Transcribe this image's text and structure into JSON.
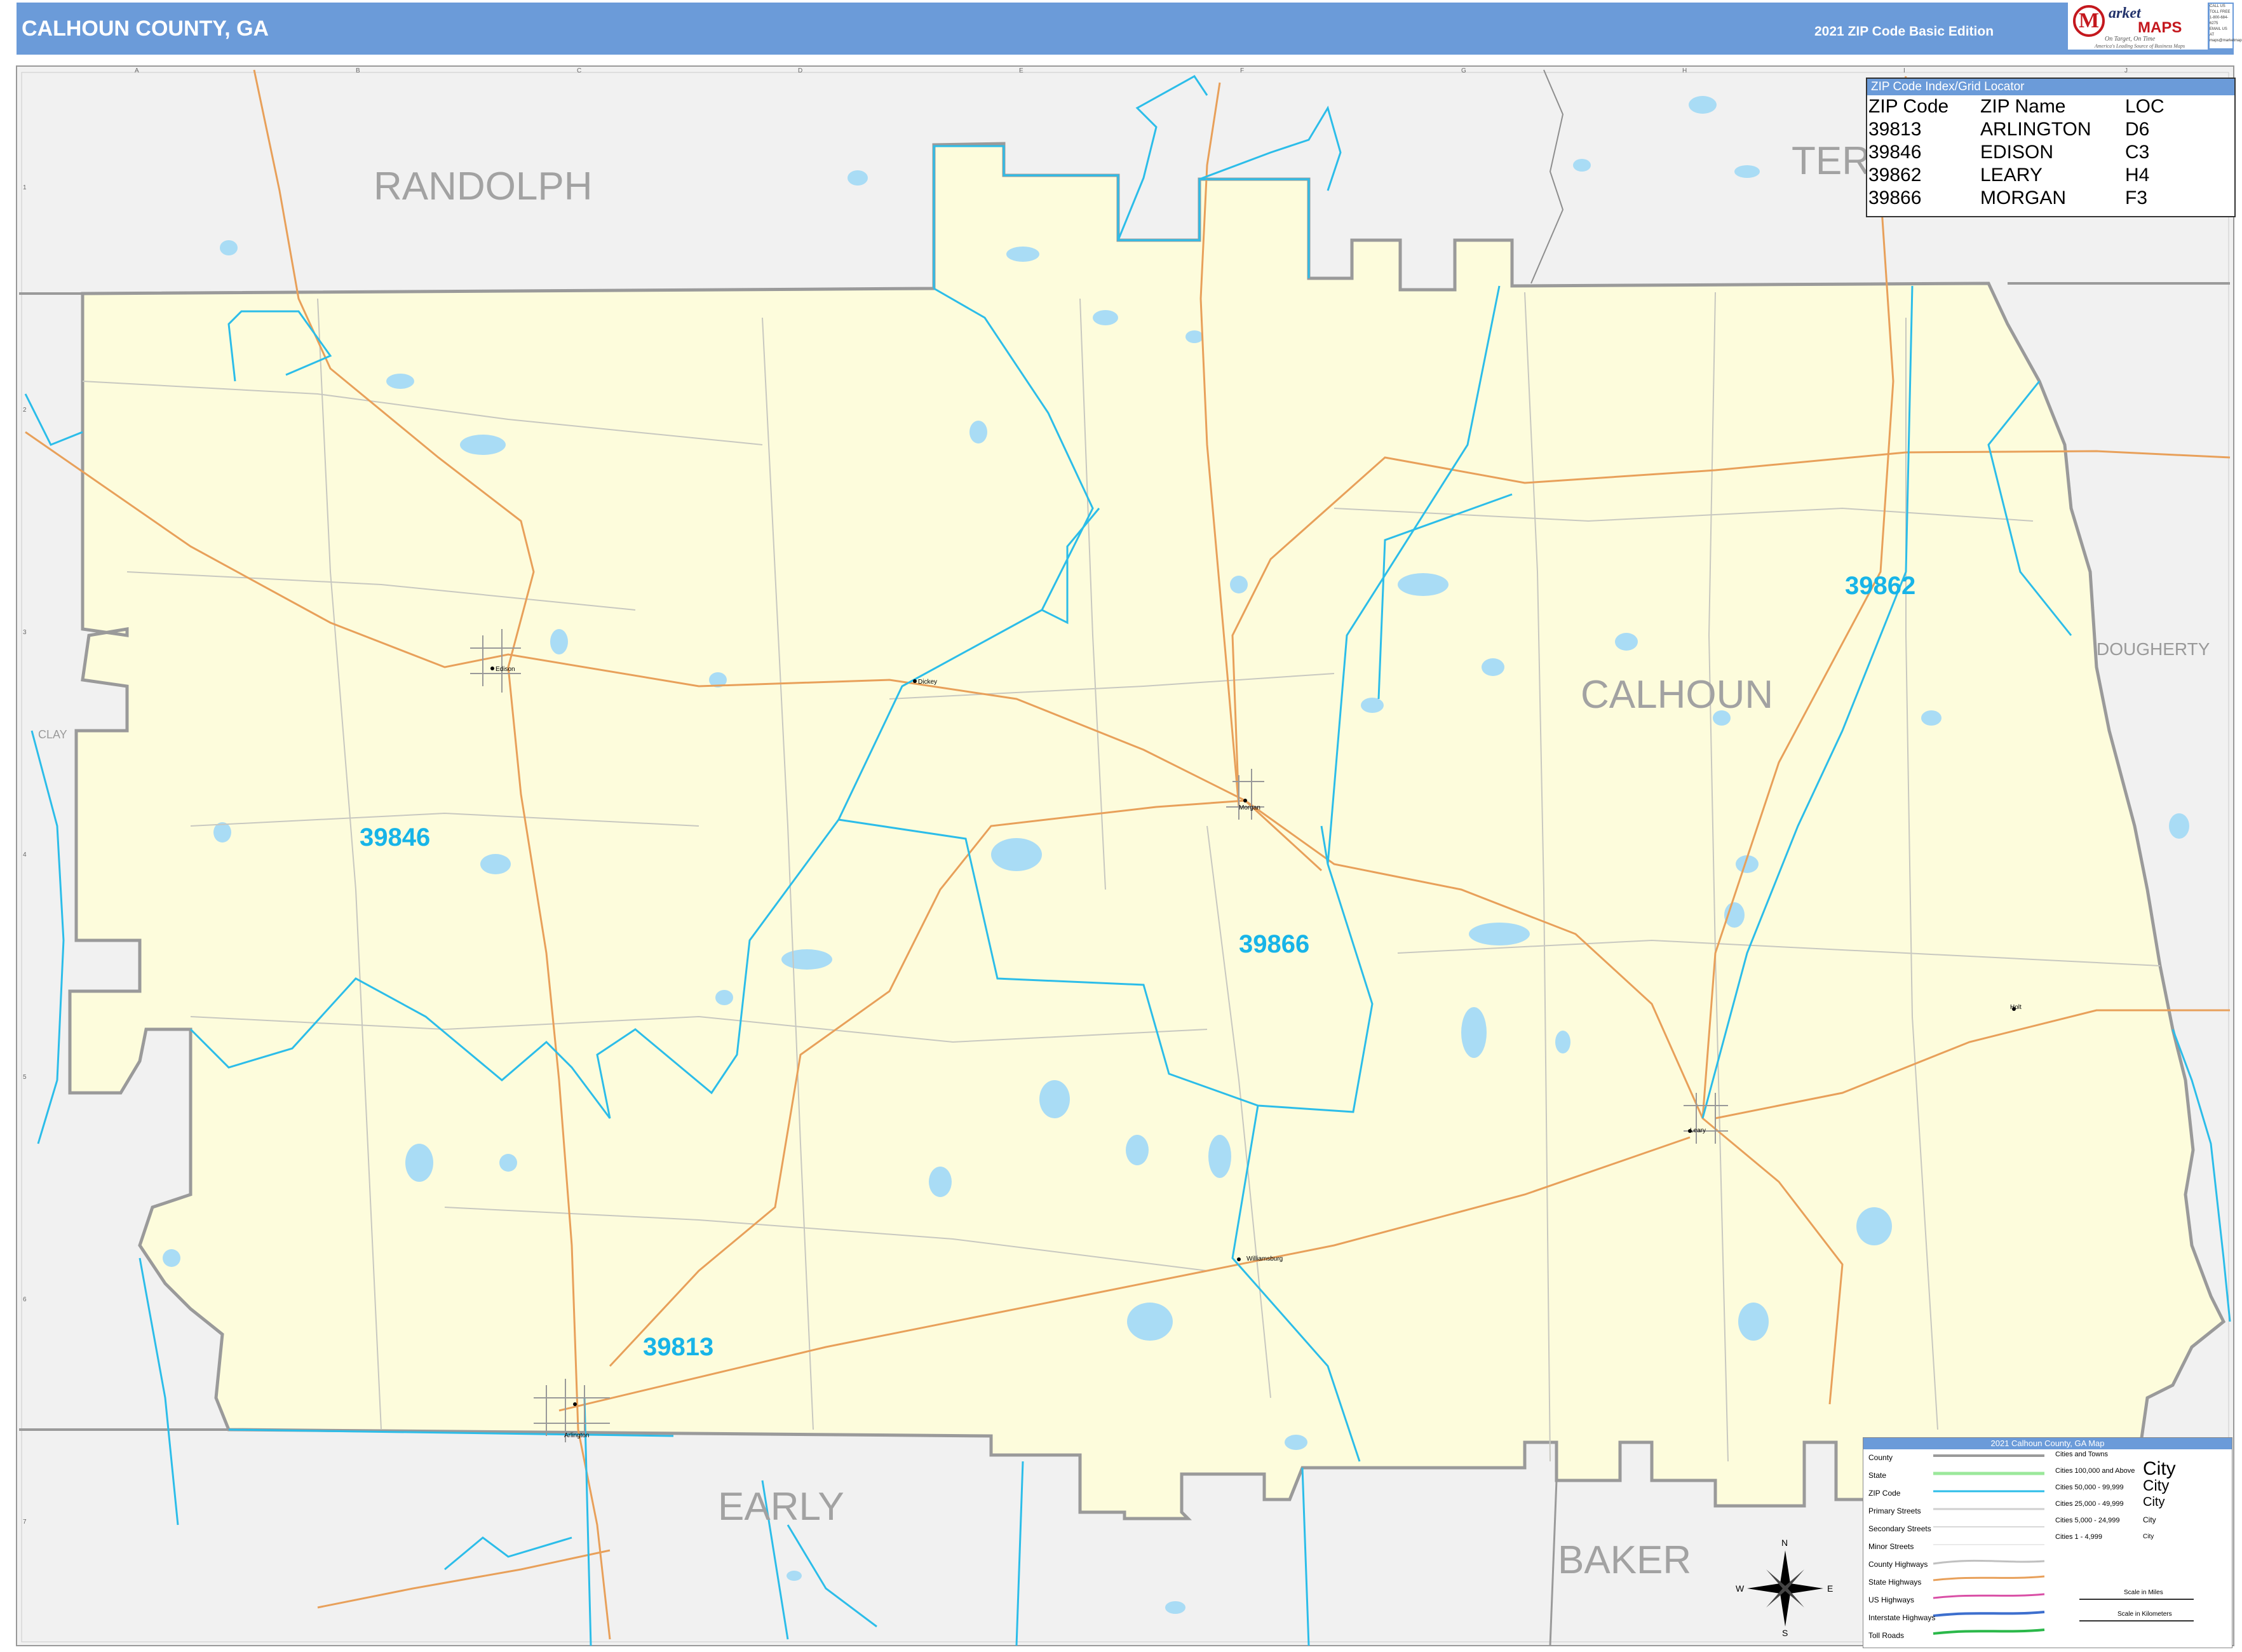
{
  "header": {
    "title": "CALHOUN COUNTY, GA",
    "edition": "2021 ZIP Code Basic Edition",
    "logo": {
      "letter": "M",
      "arket": "arket",
      "maps": "MAPS",
      "tagline": "On Target, On Time",
      "subtagline": "America's Leading Source of Business Maps"
    },
    "contact": [
      "CALL US TOLL FREE",
      "1-800-684-6275",
      "EMAIL US AT",
      "maps@marketmaps.com"
    ]
  },
  "zip_index": {
    "title": "ZIP Code Index/Grid Locator",
    "columns": [
      "ZIP Code",
      "ZIP Name",
      "LOC"
    ],
    "rows": [
      [
        "39813",
        "ARLINGTON",
        "D6"
      ],
      [
        "39846",
        "EDISON",
        "C3"
      ],
      [
        "39862",
        "LEARY",
        "H4"
      ],
      [
        "39866",
        "MORGAN",
        "F3"
      ]
    ]
  },
  "county_labels": {
    "randolph": "RANDOLPH",
    "terrell": "TER",
    "calhoun": "CALHOUN",
    "dougherty": "DOUGHERTY",
    "clay": "CLAY",
    "early": "EARLY",
    "baker": "BAKER"
  },
  "zip_labels": {
    "z39846": "39846",
    "z39862": "39862",
    "z39866": "39866",
    "z39813": "39813"
  },
  "towns": {
    "edison": "Edison",
    "dickey": "Dickey",
    "morgan": "Morgan",
    "leary": "Leary",
    "williamsburg": "Williamsburg",
    "arlington": "Arlington",
    "holt": "Holt"
  },
  "grid": {
    "columns": [
      "A",
      "B",
      "C",
      "D",
      "E",
      "F",
      "G",
      "H",
      "I",
      "J"
    ],
    "rows": [
      "1",
      "2",
      "3",
      "4",
      "5",
      "6",
      "7"
    ]
  },
  "compass": {
    "n": "N",
    "s": "S",
    "e": "E",
    "w": "W"
  },
  "legend": {
    "title": "2021 Calhoun County, GA Map",
    "items": [
      "County",
      "State",
      "ZIP Code",
      "Primary Streets",
      "Secondary Streets",
      "Minor Streets",
      "County Highways",
      "State Highways",
      "US Highways",
      "Interstate Highways",
      "Toll Roads"
    ],
    "cities_title": "Cities and Towns",
    "cities": [
      "Cities 100,000 and Above",
      "Cities 50,000 - 99,999",
      "Cities 25,000 - 49,999",
      "Cities 5,000 - 24,999",
      "Cities 1 - 4,999"
    ],
    "city_samples": [
      "City",
      "City",
      "City",
      "City",
      "City"
    ],
    "scale_miles": "Scale in Miles",
    "scale_km": "Scale in Kilometers"
  },
  "colors": {
    "county_fill": "#fdfcdc",
    "outside": "#f1f1f1",
    "water": "#a9dcf5",
    "zip_line": "#2cbde9",
    "zip_text": "#17b4e8",
    "road_orange": "#e8a05a",
    "header": "#6b9bd9"
  }
}
